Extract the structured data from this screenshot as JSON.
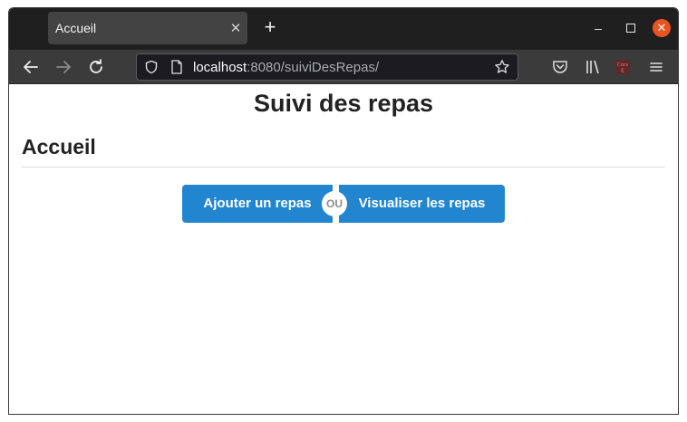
{
  "browser": {
    "tab_title": "Accueil",
    "tab_close_glyph": "✕",
    "new_tab_glyph": "+",
    "url_host": "localhost",
    "url_path": ":8080/suiviDesRepas/",
    "window_minimize_glyph": "–",
    "window_close_glyph": "✕",
    "icons": [
      "back-arrow-icon",
      "forward-arrow-icon",
      "reload-icon",
      "shield-icon",
      "page-icon",
      "bookmark-star-icon",
      "pocket-icon",
      "library-icon",
      "cors-extension-icon",
      "hamburger-menu-icon"
    ],
    "extension_label_top": "Cors",
    "extension_label_bottom": "E",
    "colors": {
      "accent_close": "#e95420",
      "tab_bg": "#434343",
      "toolbar_bg": "#3b3b3b"
    }
  },
  "page": {
    "title": "Suivi des repas",
    "section_title": "Accueil",
    "buttons": {
      "add_meal": "Ajouter un repas",
      "separator": "OU",
      "view_meals": "Visualiser les repas"
    },
    "colors": {
      "primary": "#2185d0",
      "text": "#222222"
    }
  }
}
